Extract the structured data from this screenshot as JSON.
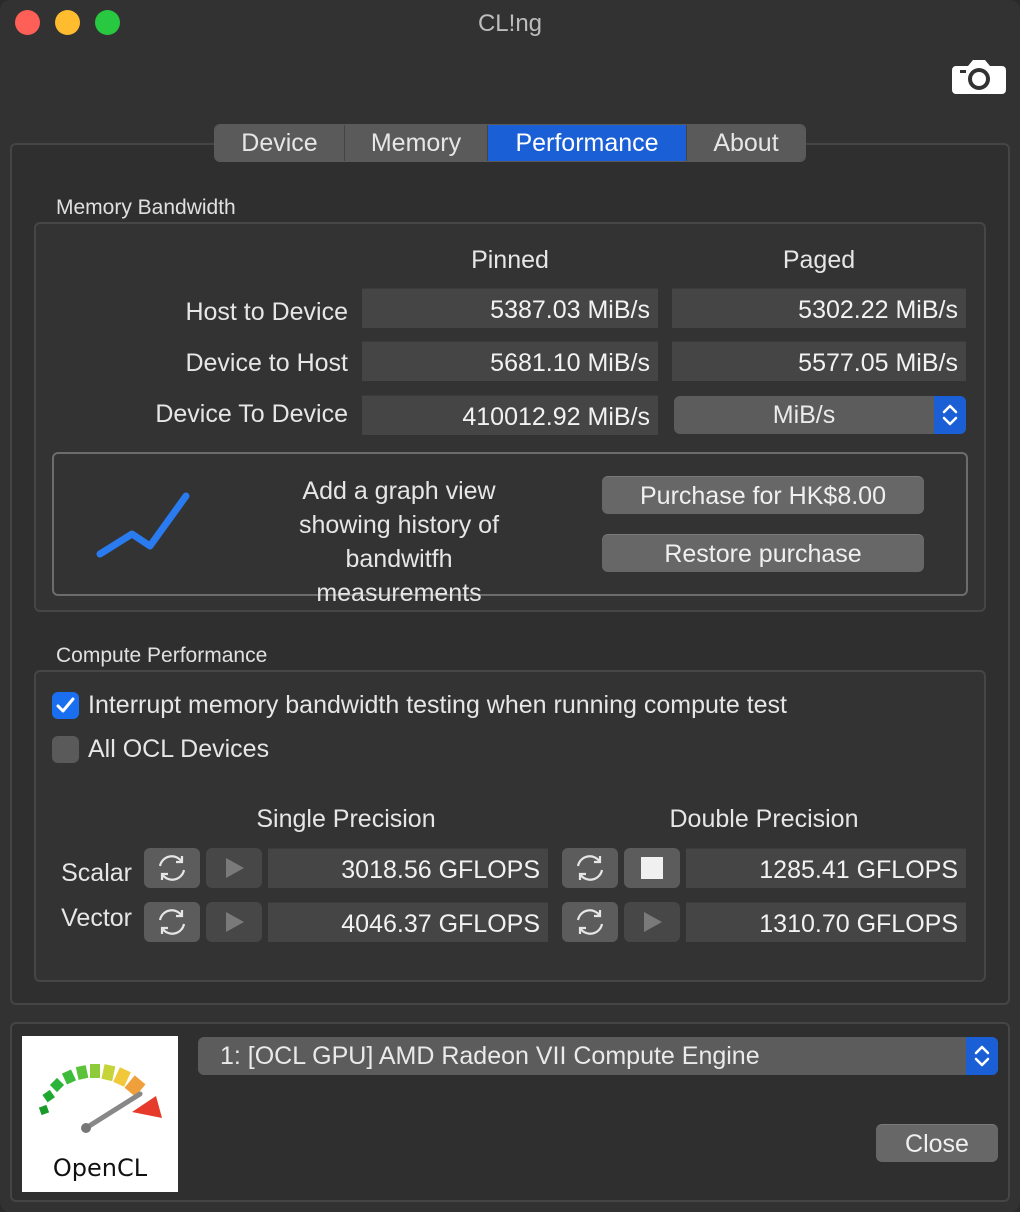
{
  "window": {
    "title": "CL!ng"
  },
  "tabs": [
    {
      "label": "Device",
      "active": false
    },
    {
      "label": "Memory",
      "active": false
    },
    {
      "label": "Performance",
      "active": true
    },
    {
      "label": "About",
      "active": false
    }
  ],
  "memory_bandwidth": {
    "group_label": "Memory Bandwidth",
    "col_pinned": "Pinned",
    "col_paged": "Paged",
    "rows": [
      {
        "label": "Host to Device",
        "pinned": "5387.03 MiB/s",
        "paged": "5302.22 MiB/s"
      },
      {
        "label": "Device to Host",
        "pinned": "5681.10 MiB/s",
        "paged": "5577.05 MiB/s"
      },
      {
        "label": "Device To Device",
        "pinned": "410012.92 MiB/s",
        "paged_popup": "MiB/s"
      }
    ]
  },
  "promo": {
    "text": "Add a graph view showing history of bandwitfh measurements",
    "purchase_label": "Purchase for HK$8.00",
    "restore_label": "Restore purchase"
  },
  "compute_performance": {
    "group_label": "Compute Performance",
    "interrupt_checkbox": {
      "label": "Interrupt memory bandwidth testing when running compute test",
      "checked": true
    },
    "all_devices_checkbox": {
      "label": "All OCL Devices",
      "checked": false
    },
    "col_single": "Single Precision",
    "col_double": "Double Precision",
    "rows": [
      {
        "label": "Scalar",
        "single": "3018.56 GFLOPS",
        "double": "1285.41 GFLOPS"
      },
      {
        "label": "Vector",
        "single": "4046.37 GFLOPS",
        "double": "1310.70 GFLOPS"
      }
    ]
  },
  "device_select": {
    "value": "1: [OCL GPU] AMD Radeon VII Compute Engine"
  },
  "logo": {
    "text": "OpenCL"
  },
  "close_label": "Close",
  "colors": {
    "accent": "#1a5fd6",
    "checkbox": "#1a6ff0",
    "graph_line": "#2a7bf0"
  }
}
